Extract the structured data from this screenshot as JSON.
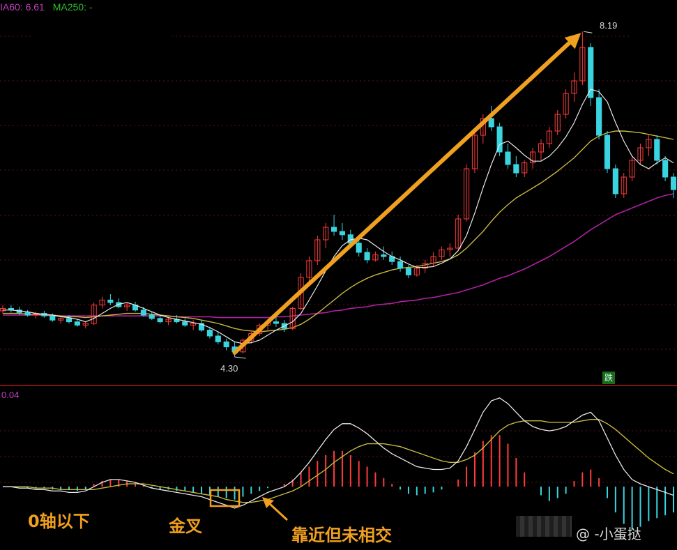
{
  "legend": {
    "ma60": "IA60: 6.61",
    "ma250": "MA250: -",
    "colors": {
      "ma60": "#c040c0",
      "ma250": "#30c030"
    }
  },
  "macd_label": "0.04",
  "price_high_label": "8.19",
  "price_low_label": "4.30",
  "die_badge": "跌",
  "annotations": {
    "below_zero": "0轴以下",
    "golden_cross": "金叉",
    "near_not_cross": "靠近但未相交"
  },
  "watermark": "@ -小蛋挞",
  "chart_data": [
    {
      "type": "candlestick",
      "title": "",
      "ylim": [
        4.0,
        8.4
      ],
      "grid": true,
      "colors": {
        "up": "#ff3b3b",
        "down": "#3ad4e0",
        "ma_short": "#e8e8e8",
        "ma_mid": "#c8b840",
        "ma_long": "#b020a0",
        "trend_arrow": "#f0a020"
      },
      "candles": [
        [
          4.85,
          4.92,
          4.82,
          4.88
        ],
        [
          4.88,
          4.92,
          4.83,
          4.86
        ],
        [
          4.86,
          4.9,
          4.8,
          4.83
        ],
        [
          4.83,
          4.86,
          4.78,
          4.8
        ],
        [
          4.8,
          4.84,
          4.76,
          4.82
        ],
        [
          4.82,
          4.85,
          4.77,
          4.79
        ],
        [
          4.79,
          4.82,
          4.72,
          4.74
        ],
        [
          4.74,
          4.78,
          4.7,
          4.76
        ],
        [
          4.76,
          4.8,
          4.7,
          4.72
        ],
        [
          4.72,
          4.75,
          4.66,
          4.68
        ],
        [
          4.68,
          4.72,
          4.64,
          4.7
        ],
        [
          4.7,
          4.95,
          4.68,
          4.92
        ],
        [
          4.92,
          5.02,
          4.88,
          4.98
        ],
        [
          4.98,
          5.05,
          4.92,
          4.95
        ],
        [
          4.95,
          5.0,
          4.88,
          4.9
        ],
        [
          4.9,
          4.95,
          4.85,
          4.92
        ],
        [
          4.92,
          4.96,
          4.84,
          4.86
        ],
        [
          4.86,
          4.9,
          4.78,
          4.8
        ],
        [
          4.8,
          4.84,
          4.74,
          4.76
        ],
        [
          4.76,
          4.8,
          4.7,
          4.72
        ],
        [
          4.72,
          4.78,
          4.68,
          4.75
        ],
        [
          4.75,
          4.8,
          4.7,
          4.72
        ],
        [
          4.72,
          4.76,
          4.66,
          4.68
        ],
        [
          4.68,
          4.74,
          4.62,
          4.7
        ],
        [
          4.7,
          4.74,
          4.6,
          4.62
        ],
        [
          4.62,
          4.66,
          4.52,
          4.55
        ],
        [
          4.55,
          4.6,
          4.45,
          4.48
        ],
        [
          4.48,
          4.52,
          4.38,
          4.42
        ],
        [
          4.42,
          4.48,
          4.3,
          4.36
        ],
        [
          4.36,
          4.52,
          4.34,
          4.5
        ],
        [
          4.5,
          4.6,
          4.46,
          4.58
        ],
        [
          4.58,
          4.7,
          4.55,
          4.68
        ],
        [
          4.68,
          4.75,
          4.62,
          4.72
        ],
        [
          4.72,
          4.78,
          4.66,
          4.7
        ],
        [
          4.7,
          4.74,
          4.6,
          4.64
        ],
        [
          4.64,
          4.9,
          4.62,
          4.88
        ],
        [
          4.88,
          5.3,
          4.86,
          5.25
        ],
        [
          5.25,
          5.5,
          5.2,
          5.45
        ],
        [
          5.45,
          5.75,
          5.4,
          5.7
        ],
        [
          5.7,
          5.9,
          5.6,
          5.85
        ],
        [
          5.85,
          6.0,
          5.75,
          5.8
        ],
        [
          5.8,
          5.9,
          5.7,
          5.76
        ],
        [
          5.76,
          5.82,
          5.62,
          5.66
        ],
        [
          5.66,
          5.72,
          5.5,
          5.55
        ],
        [
          5.55,
          5.6,
          5.42,
          5.46
        ],
        [
          5.46,
          5.56,
          5.44,
          5.52
        ],
        [
          5.52,
          5.62,
          5.46,
          5.5
        ],
        [
          5.5,
          5.56,
          5.4,
          5.44
        ],
        [
          5.44,
          5.5,
          5.32,
          5.36
        ],
        [
          5.36,
          5.4,
          5.24,
          5.28
        ],
        [
          5.28,
          5.4,
          5.26,
          5.36
        ],
        [
          5.36,
          5.46,
          5.3,
          5.42
        ],
        [
          5.42,
          5.55,
          5.38,
          5.5
        ],
        [
          5.5,
          5.62,
          5.46,
          5.58
        ],
        [
          5.58,
          5.66,
          5.5,
          5.6
        ],
        [
          5.6,
          6.0,
          5.58,
          5.95
        ],
        [
          5.95,
          6.6,
          5.92,
          6.55
        ],
        [
          6.55,
          7.0,
          6.5,
          6.95
        ],
        [
          6.95,
          7.2,
          6.85,
          7.15
        ],
        [
          7.15,
          7.3,
          7.0,
          7.05
        ],
        [
          7.05,
          7.1,
          6.7,
          6.75
        ],
        [
          6.75,
          6.85,
          6.55,
          6.6
        ],
        [
          6.6,
          6.7,
          6.45,
          6.5
        ],
        [
          6.5,
          6.65,
          6.45,
          6.62
        ],
        [
          6.62,
          6.8,
          6.55,
          6.75
        ],
        [
          6.75,
          6.9,
          6.65,
          6.85
        ],
        [
          6.85,
          7.05,
          6.8,
          7.0
        ],
        [
          7.0,
          7.25,
          6.95,
          7.2
        ],
        [
          7.2,
          7.5,
          7.15,
          7.45
        ],
        [
          7.45,
          7.7,
          7.35,
          7.6
        ],
        [
          7.6,
          8.19,
          7.55,
          8.0
        ],
        [
          8.0,
          8.05,
          7.3,
          7.4
        ],
        [
          7.4,
          7.5,
          6.9,
          6.95
        ],
        [
          6.95,
          7.0,
          6.5,
          6.55
        ],
        [
          6.55,
          6.6,
          6.2,
          6.25
        ],
        [
          6.25,
          6.5,
          6.2,
          6.45
        ],
        [
          6.45,
          6.7,
          6.4,
          6.65
        ],
        [
          6.65,
          6.85,
          6.6,
          6.8
        ],
        [
          6.8,
          6.95,
          6.7,
          6.9
        ],
        [
          6.9,
          6.95,
          6.6,
          6.65
        ],
        [
          6.65,
          6.7,
          6.4,
          6.45
        ],
        [
          6.45,
          6.5,
          6.2,
          6.3
        ]
      ],
      "ma_short": [
        4.86,
        4.86,
        4.85,
        4.84,
        4.82,
        4.81,
        4.8,
        4.78,
        4.77,
        4.75,
        4.72,
        4.76,
        4.82,
        4.88,
        4.93,
        4.95,
        4.92,
        4.88,
        4.84,
        4.8,
        4.77,
        4.75,
        4.73,
        4.71,
        4.69,
        4.65,
        4.6,
        4.54,
        4.48,
        4.46,
        4.47,
        4.5,
        4.56,
        4.62,
        4.67,
        4.72,
        4.82,
        4.98,
        5.15,
        5.33,
        5.5,
        5.63,
        5.7,
        5.72,
        5.7,
        5.63,
        5.56,
        5.5,
        5.46,
        5.41,
        5.37,
        5.37,
        5.38,
        5.42,
        5.47,
        5.57,
        5.75,
        6.02,
        6.32,
        6.6,
        6.84,
        6.88,
        6.8,
        6.71,
        6.64,
        6.64,
        6.7,
        6.8,
        6.93,
        7.1,
        7.32,
        7.5,
        7.47,
        7.35,
        7.1,
        6.88,
        6.7,
        6.6,
        6.55,
        6.62,
        6.68,
        6.62
      ],
      "ma_mid": [
        4.82,
        4.82,
        4.82,
        4.81,
        4.81,
        4.8,
        4.8,
        4.79,
        4.78,
        4.78,
        4.77,
        4.78,
        4.79,
        4.8,
        4.81,
        4.82,
        4.82,
        4.82,
        4.81,
        4.8,
        4.79,
        4.78,
        4.77,
        4.76,
        4.74,
        4.72,
        4.7,
        4.67,
        4.64,
        4.62,
        4.61,
        4.6,
        4.61,
        4.62,
        4.63,
        4.65,
        4.69,
        4.75,
        4.82,
        4.9,
        4.98,
        5.06,
        5.13,
        5.19,
        5.24,
        5.28,
        5.31,
        5.34,
        5.36,
        5.37,
        5.38,
        5.4,
        5.42,
        5.44,
        5.47,
        5.52,
        5.6,
        5.7,
        5.8,
        5.92,
        6.03,
        6.12,
        6.2,
        6.26,
        6.32,
        6.38,
        6.45,
        6.52,
        6.6,
        6.68,
        6.78,
        6.88,
        6.94,
        6.98,
        7.0,
        7.0,
        6.99,
        6.98,
        6.96,
        6.94,
        6.92,
        6.9
      ],
      "ma_long": [
        4.8,
        4.8,
        4.8,
        4.8,
        4.8,
        4.8,
        4.79,
        4.79,
        4.79,
        4.79,
        4.79,
        4.79,
        4.79,
        4.79,
        4.79,
        4.79,
        4.79,
        4.79,
        4.79,
        4.79,
        4.79,
        4.78,
        4.78,
        4.78,
        4.78,
        4.78,
        4.77,
        4.77,
        4.77,
        4.77,
        4.77,
        4.77,
        4.77,
        4.78,
        4.78,
        4.79,
        4.8,
        4.81,
        4.82,
        4.83,
        4.85,
        4.86,
        4.88,
        4.89,
        4.9,
        4.92,
        4.93,
        4.94,
        4.96,
        4.97,
        4.98,
        5.0,
        5.01,
        5.03,
        5.05,
        5.07,
        5.1,
        5.13,
        5.16,
        5.2,
        5.24,
        5.27,
        5.31,
        5.35,
        5.4,
        5.45,
        5.5,
        5.56,
        5.62,
        5.68,
        5.75,
        5.82,
        5.88,
        5.94,
        6.0,
        6.04,
        6.08,
        6.12,
        6.16,
        6.2,
        6.23,
        6.25
      ],
      "high": {
        "value": 8.19,
        "index": 70
      },
      "low": {
        "value": 4.3,
        "index": 28
      },
      "trend_arrow": {
        "from": [
          28,
          4.35
        ],
        "to": [
          70,
          8.19
        ]
      }
    },
    {
      "type": "macd",
      "ylim": [
        -0.35,
        0.6
      ],
      "colors": {
        "dif": "#e8e8e8",
        "dea": "#c8b840",
        "pos": "#ff3b3b",
        "neg": "#3ad4e0"
      },
      "hist": [
        0.0,
        0.0,
        0.0,
        -0.01,
        -0.01,
        -0.01,
        -0.02,
        -0.02,
        -0.02,
        -0.03,
        -0.02,
        0.02,
        0.04,
        0.05,
        0.05,
        0.04,
        0.03,
        0.01,
        -0.01,
        -0.02,
        -0.02,
        -0.03,
        -0.03,
        -0.04,
        -0.05,
        -0.06,
        -0.07,
        -0.08,
        -0.09,
        -0.07,
        -0.05,
        -0.03,
        -0.01,
        0.0,
        0.02,
        0.05,
        0.1,
        0.14,
        0.18,
        0.22,
        0.25,
        0.25,
        0.22,
        0.18,
        0.14,
        0.1,
        0.06,
        0.02,
        -0.02,
        -0.05,
        -0.06,
        -0.05,
        -0.04,
        -0.02,
        0.0,
        0.05,
        0.14,
        0.24,
        0.32,
        0.36,
        0.36,
        0.3,
        0.2,
        0.1,
        0.0,
        -0.06,
        -0.1,
        -0.08,
        -0.05,
        0.04,
        0.1,
        0.12,
        0.06,
        -0.08,
        -0.18,
        -0.26,
        -0.3,
        -0.28,
        -0.24,
        -0.22,
        -0.2,
        -0.18
      ],
      "dif": [
        0.0,
        0.0,
        -0.01,
        -0.01,
        -0.02,
        -0.02,
        -0.03,
        -0.03,
        -0.04,
        -0.04,
        -0.03,
        0.0,
        0.03,
        0.05,
        0.05,
        0.04,
        0.03,
        0.01,
        -0.01,
        -0.02,
        -0.03,
        -0.04,
        -0.05,
        -0.06,
        -0.07,
        -0.09,
        -0.11,
        -0.13,
        -0.15,
        -0.13,
        -0.1,
        -0.07,
        -0.04,
        -0.02,
        0.0,
        0.04,
        0.1,
        0.17,
        0.25,
        0.33,
        0.4,
        0.44,
        0.44,
        0.41,
        0.37,
        0.32,
        0.27,
        0.23,
        0.2,
        0.17,
        0.14,
        0.13,
        0.12,
        0.12,
        0.13,
        0.18,
        0.28,
        0.4,
        0.52,
        0.6,
        0.62,
        0.58,
        0.52,
        0.46,
        0.42,
        0.4,
        0.39,
        0.4,
        0.42,
        0.46,
        0.5,
        0.52,
        0.46,
        0.34,
        0.22,
        0.12,
        0.05,
        0.02,
        0.0,
        -0.02,
        -0.04,
        -0.06
      ],
      "dea": [
        0.0,
        0.0,
        0.0,
        0.0,
        -0.01,
        -0.01,
        -0.01,
        -0.02,
        -0.02,
        -0.02,
        -0.02,
        -0.02,
        -0.01,
        0.0,
        0.01,
        0.02,
        0.02,
        0.02,
        0.01,
        0.0,
        -0.01,
        -0.02,
        -0.03,
        -0.04,
        -0.05,
        -0.06,
        -0.07,
        -0.09,
        -0.1,
        -0.11,
        -0.11,
        -0.1,
        -0.09,
        -0.07,
        -0.05,
        -0.03,
        0.0,
        0.04,
        0.08,
        0.12,
        0.17,
        0.21,
        0.25,
        0.28,
        0.3,
        0.3,
        0.3,
        0.29,
        0.28,
        0.26,
        0.24,
        0.22,
        0.2,
        0.18,
        0.17,
        0.17,
        0.19,
        0.22,
        0.27,
        0.33,
        0.39,
        0.43,
        0.45,
        0.46,
        0.46,
        0.46,
        0.45,
        0.45,
        0.45,
        0.45,
        0.46,
        0.47,
        0.47,
        0.44,
        0.4,
        0.35,
        0.3,
        0.25,
        0.2,
        0.16,
        0.12,
        0.09
      ]
    }
  ]
}
